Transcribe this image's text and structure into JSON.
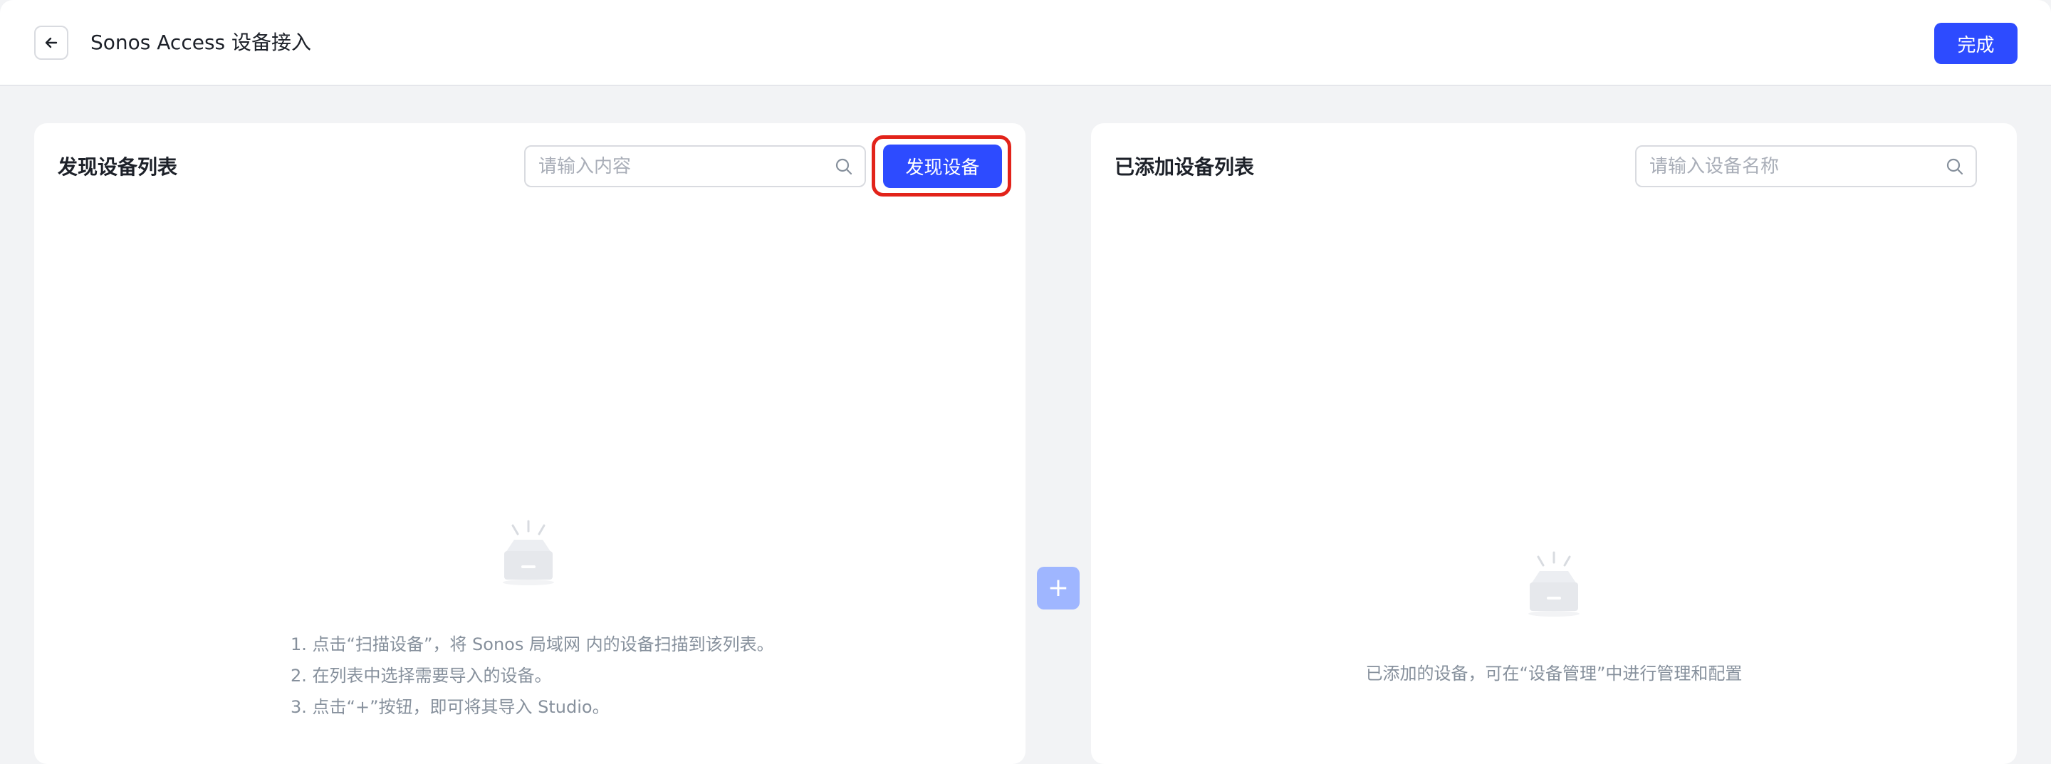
{
  "header": {
    "title": "Sonos Access 设备接入",
    "done_label": "完成",
    "back_icon": "arrow-left-icon"
  },
  "discovered": {
    "title": "发现设备列表",
    "search_placeholder": "请输入内容",
    "discover_label": "发现设备",
    "hints": [
      "1. 点击“扫描设备”，将 Sonos 局域网 内的设备扫描到该列表。",
      "2. 在列表中选择需要导入的设备。",
      "3. 点击“+”按钮，即可将其导入 Studio。"
    ]
  },
  "added": {
    "title": "已添加设备列表",
    "search_placeholder": "请输入设备名称",
    "empty_text": "已添加的设备，可在“设备管理”中进行管理和配置"
  },
  "transfer": {
    "add_label": "+"
  },
  "colors": {
    "primary": "#2d4bff",
    "highlight_outline": "#e2231a",
    "add_button_disabled": "#9fb6ff",
    "background": "#f2f3f5"
  }
}
